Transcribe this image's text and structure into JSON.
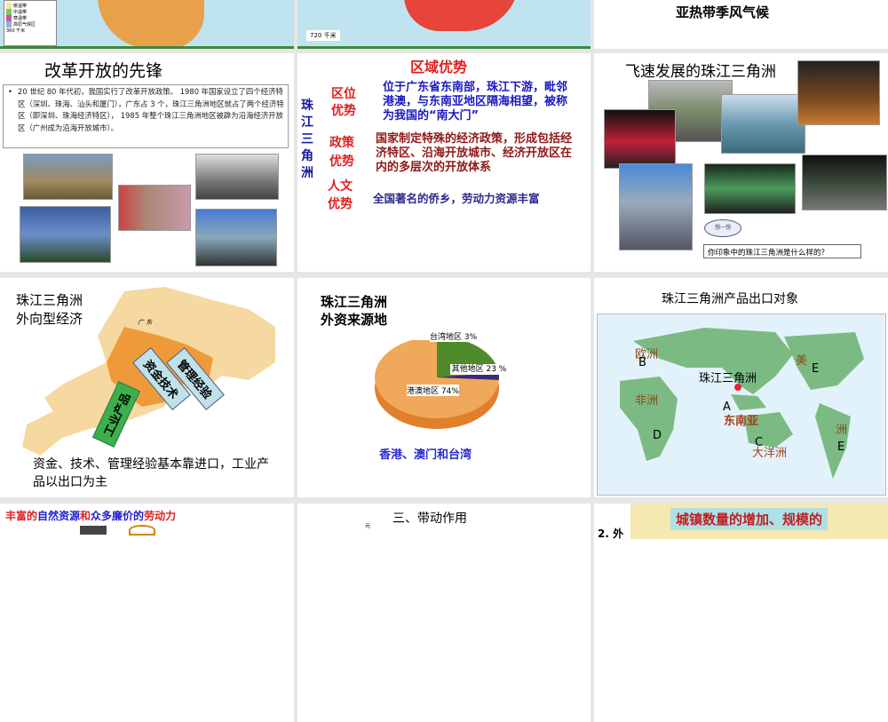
{
  "slides": [
    {
      "id": "s-map1",
      "legend": [
        "暖温带",
        "中温带",
        "寒温带",
        "高原气候区"
      ],
      "scale": "360 千米"
    },
    {
      "id": "s-map2",
      "scale": "720 千米"
    },
    {
      "id": "s-climate",
      "caption": "亚热带季风气候"
    },
    {
      "id": "s-pioneer",
      "title": "改革开放的先锋",
      "bullet": "20 世纪 80 年代初，我国实行了改革开放政策。 1980 年国家设立了四个经济特区（深圳、珠海、汕头和厦门），广东占 3 个，珠江三角洲地区就占了两个经济特区（即深圳、珠海经济特区）， 1985 年整个珠江三角洲地区被辟为沿海经济开放区（广州成为沿海开放城市）。"
    },
    {
      "id": "s-advantage",
      "title": "区域优势",
      "side_label": "珠江三角洲",
      "rows": [
        {
          "label": "区位优势",
          "text": "位于广东省东南部，珠江下游，毗邻港澳，与东南亚地区隔海相望，被称为我国的“南大门”"
        },
        {
          "label": "政策优势",
          "text": "国家制定特殊的经济政策，形成包括经济特区、沿海开放城市、经济开放区在内的多层次的开放体系"
        },
        {
          "label": "人文优势",
          "text": "全国著名的侨乡，劳动力资源丰富"
        }
      ]
    },
    {
      "id": "s-development",
      "title": "飞速发展的珠江三角洲",
      "think": "想一想",
      "question": "你印象中的珠江三角洲是什么样的？"
    },
    {
      "id": "s-export-economy",
      "title_line1": "珠江三角洲",
      "title_line2": "外向型经济",
      "province": "广 东",
      "arrows": [
        "资金技术",
        "管理经验",
        "工业产品"
      ],
      "caption": "资金、技术、管理经验基本靠进口，工业产品以出口为主"
    },
    {
      "id": "s-foreign-capital",
      "title_line1": "珠江三角洲",
      "title_line2": "外资来源地",
      "caption": "香港、澳门和台湾"
    },
    {
      "id": "s-export-targets",
      "title": "珠江三角洲产品出口对象",
      "labels": {
        "europe": "欧洲",
        "africa": "非洲",
        "america1": "美",
        "america2": "洲",
        "sea": "东南亚",
        "oceania": "大洋洲",
        "prd": "珠江三角洲",
        "A": "A",
        "B": "B",
        "C": "C",
        "D": "D",
        "E": "E"
      }
    },
    {
      "id": "s-resources",
      "title_part1": "丰富的",
      "title_part2": "自然资源",
      "title_part3": "和",
      "title_part4": "众多廉价的",
      "title_part5": "劳动力"
    },
    {
      "id": "s-driving",
      "title": "三、带动作用",
      "axis": "元"
    },
    {
      "id": "s-towns",
      "prefix": "2. 外",
      "text": "城镇数量的增加、规模的"
    }
  ],
  "chart_data": {
    "type": "pie",
    "title": "珠江三角洲外资来源地",
    "categories": [
      "港澳地区",
      "其他地区",
      "台湾地区"
    ],
    "values": [
      74,
      23,
      3
    ],
    "labels": [
      "港澳地区 74%",
      "其他地区 23 %",
      "台湾地区 3%"
    ],
    "colors": [
      "#f0a85a",
      "#4f8a2a",
      "#3a2a7a"
    ]
  }
}
